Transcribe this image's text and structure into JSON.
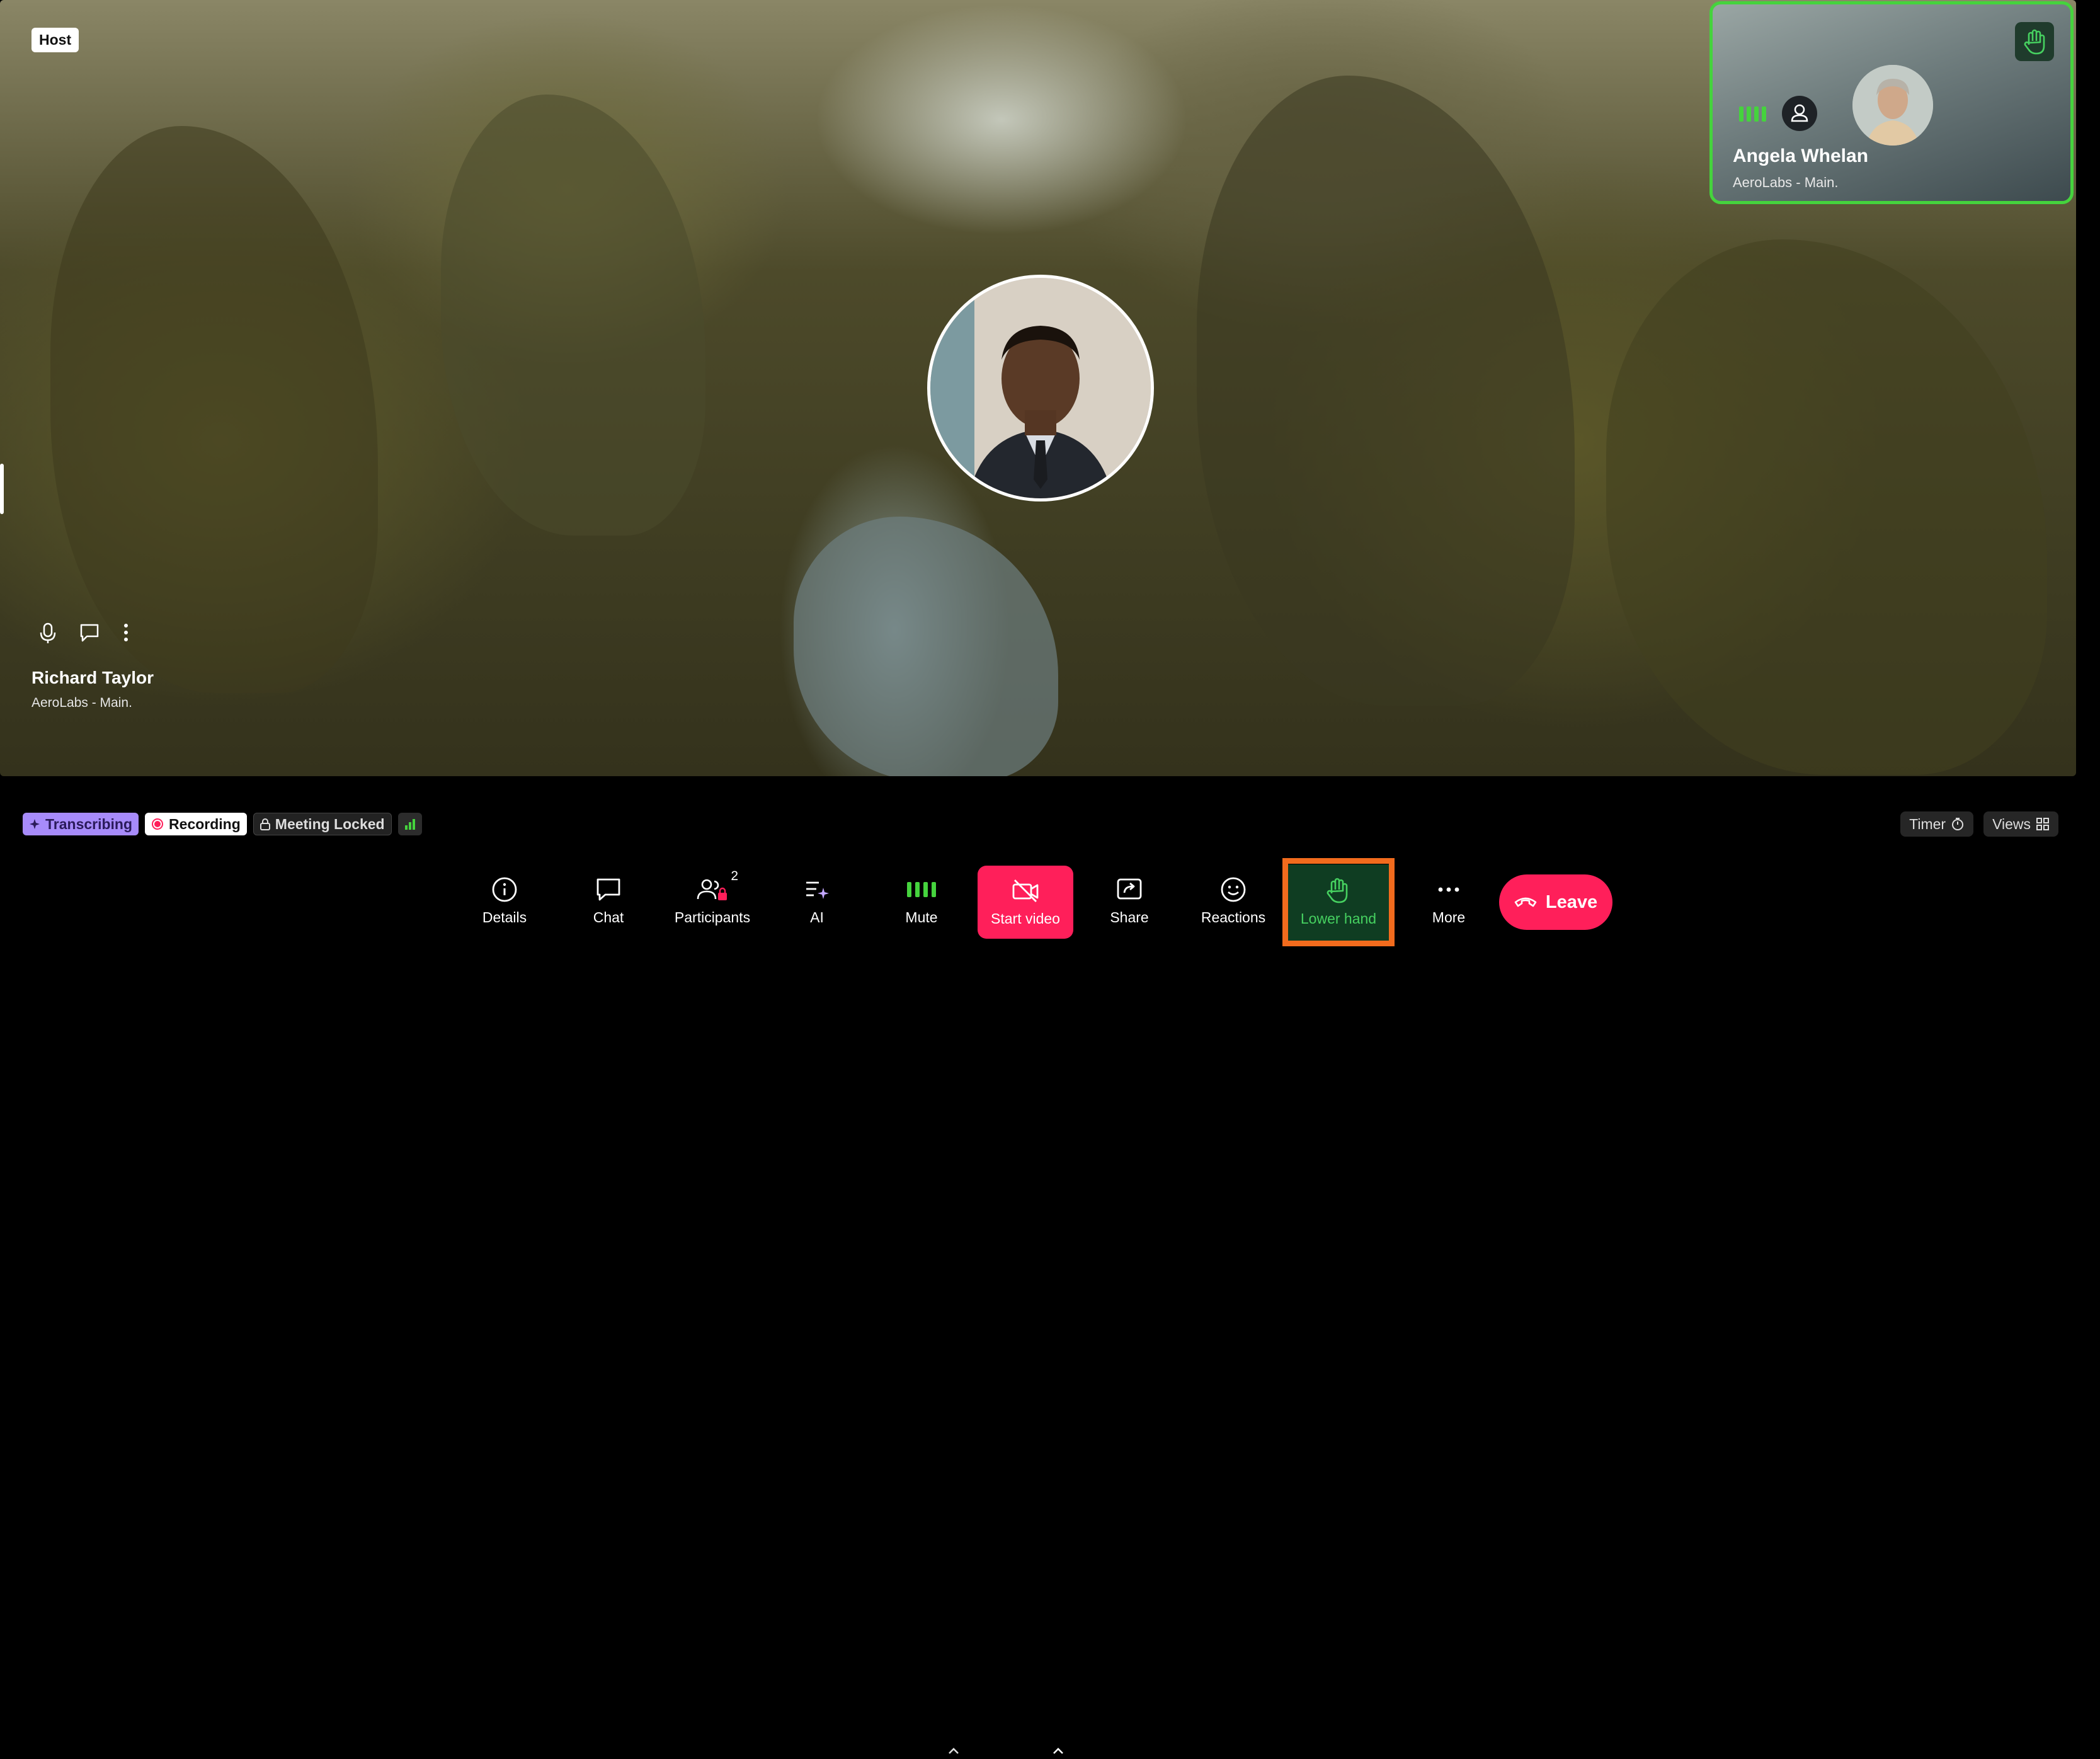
{
  "stage": {
    "host_badge": "Host",
    "self": {
      "name": "Richard Taylor",
      "org": "AeroLabs - Main."
    },
    "speaker": {
      "name": "Angela Whelan",
      "org": "AeroLabs - Main."
    }
  },
  "status": {
    "transcribing": "Transcribing",
    "recording": "Recording",
    "locked": "Meeting Locked",
    "timer": "Timer",
    "views": "Views"
  },
  "toolbar": {
    "details": "Details",
    "chat": "Chat",
    "participants": "Participants",
    "participants_count": "2",
    "ai": "AI",
    "mute": "Mute",
    "start_video": "Start video",
    "share": "Share",
    "reactions": "Reactions",
    "lower_hand": "Lower hand",
    "more": "More",
    "leave": "Leave"
  },
  "colors": {
    "accent_green": "#45d33d",
    "danger": "#ff1f5a",
    "highlight": "#f26b1d",
    "transcribing": "#a78bfa"
  }
}
